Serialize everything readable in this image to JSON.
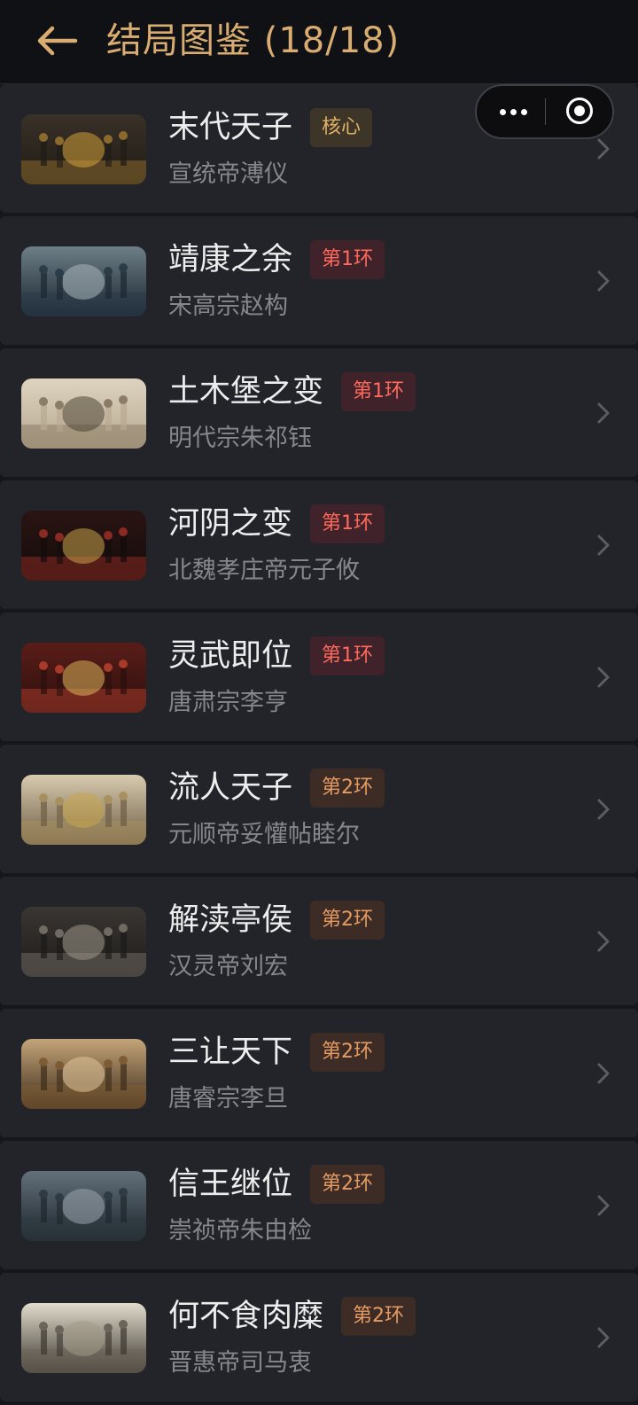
{
  "header": {
    "title": "结局图鉴 (18/18)",
    "back_icon": "arrow-left-icon",
    "accent_color": "#d9ad72"
  },
  "capsule": {
    "more_icon": "more-dots-icon",
    "close_icon": "target-circle-icon"
  },
  "items": [
    {
      "title": "末代天子",
      "tag": "核心",
      "tag_type": "core",
      "subtitle": "宣统帝溥仪",
      "thumbnail": "golden-throne-hall-painting"
    },
    {
      "title": "靖康之余",
      "tag": "第1环",
      "tag_type": "r1",
      "subtitle": "宋高宗赵构",
      "thumbnail": "boat-on-stormy-waves-painting"
    },
    {
      "title": "土木堡之变",
      "tag": "第1环",
      "tag_type": "r1",
      "subtitle": "明代宗朱祁钰",
      "thumbnail": "crowd-battle-ink-painting"
    },
    {
      "title": "河阴之变",
      "tag": "第1环",
      "tag_type": "r1",
      "subtitle": "北魏孝庄帝元子攸",
      "thumbnail": "red-fire-court-painting"
    },
    {
      "title": "灵武即位",
      "tag": "第1环",
      "tag_type": "r1",
      "subtitle": "唐肃宗李亨",
      "thumbnail": "red-tent-coronation-painting"
    },
    {
      "title": "流人天子",
      "tag": "第2环",
      "tag_type": "r2",
      "subtitle": "元顺帝妥懽帖睦尔",
      "thumbnail": "palace-hall-gathering-painting"
    },
    {
      "title": "解渎亭侯",
      "tag": "第2环",
      "tag_type": "r2",
      "subtitle": "汉灵帝刘宏",
      "thumbnail": "dark-courtyard-figures-painting"
    },
    {
      "title": "三让天下",
      "tag": "第2环",
      "tag_type": "r2",
      "subtitle": "唐睿宗李旦",
      "thumbnail": "court-assembly-painting"
    },
    {
      "title": "信王继位",
      "tag": "第2环",
      "tag_type": "r2",
      "subtitle": "崇祯帝朱由检",
      "thumbnail": "forbidden-city-rain-painting"
    },
    {
      "title": "何不食肉糜",
      "tag": "第2环",
      "tag_type": "r2",
      "subtitle": "晋惠帝司马衷",
      "thumbnail": "banquet-table-sketch-painting"
    }
  ]
}
